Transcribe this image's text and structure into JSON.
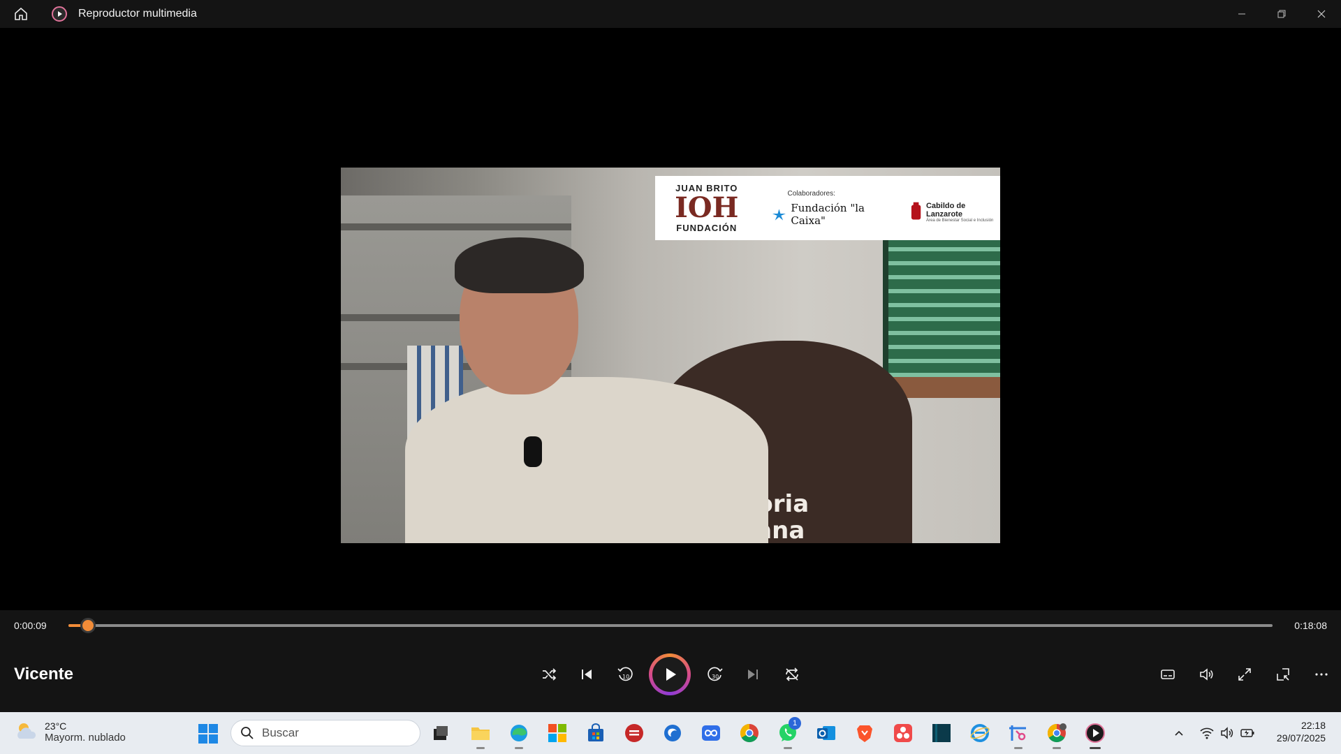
{
  "window": {
    "title": "Reproductor multimedia"
  },
  "video": {
    "banner": {
      "juan_brito_top": "JUAN BRITO",
      "juan_brito_mark": "IOH",
      "juan_brito_bottom": "FUNDACIÓN",
      "collaborators_label": "Colaboradores:",
      "caixa": "Fundación \"la Caixa\"",
      "cabildo": "Cabildo de Lanzarote",
      "cabildo_sub": "Área de Bienestar Social e Inclusión"
    },
    "background_text_1": "moria",
    "background_text_2": "ñana"
  },
  "player": {
    "elapsed": "0:00:09",
    "duration": "0:18:08",
    "progress": 0.0083,
    "track_title": "Vicente",
    "skip_back_label": "10",
    "skip_forward_label": "30",
    "accent_color": "#f28c38"
  },
  "taskbar": {
    "weather": {
      "temperature": "23°C",
      "description": "Mayorm. nublado"
    },
    "search_placeholder": "Buscar",
    "whatsapp_badge": "1",
    "clock": {
      "time": "22:18",
      "date": "29/07/2025"
    }
  }
}
